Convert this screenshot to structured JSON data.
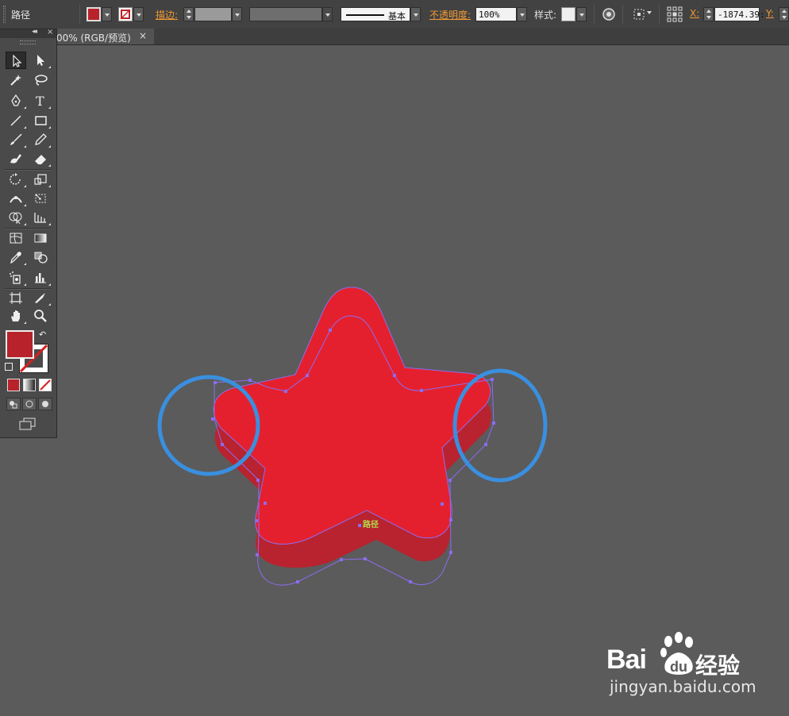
{
  "control_bar": {
    "selection_label": "路径",
    "fill_color": "#b8222b",
    "stroke_label": "描边:",
    "stroke_style_label": "基本",
    "opacity_label": "不透明度:",
    "opacity_value": "100%",
    "style_label": "样式:",
    "x_label": "X:",
    "x_value": "-1874.39:",
    "y_label": "Y:"
  },
  "document_tab": {
    "title": "00% (RGB/预览)",
    "close": "×"
  },
  "tools_panel": {
    "collapse": "◂◂",
    "close": "×",
    "fill_color": "#b8222b",
    "stroke_color": "none"
  },
  "canvas": {
    "background": "#5b5b5b",
    "object_color": "#e5202e",
    "extrude_color": "#b8232f",
    "path_color": "#8c6cf0",
    "highlight_color": "#3a8fdf",
    "hover_label": "路径"
  },
  "watermark": {
    "logo": "Bai",
    "logo_suffix": "经验",
    "url": "jingyan.baidu.com"
  }
}
